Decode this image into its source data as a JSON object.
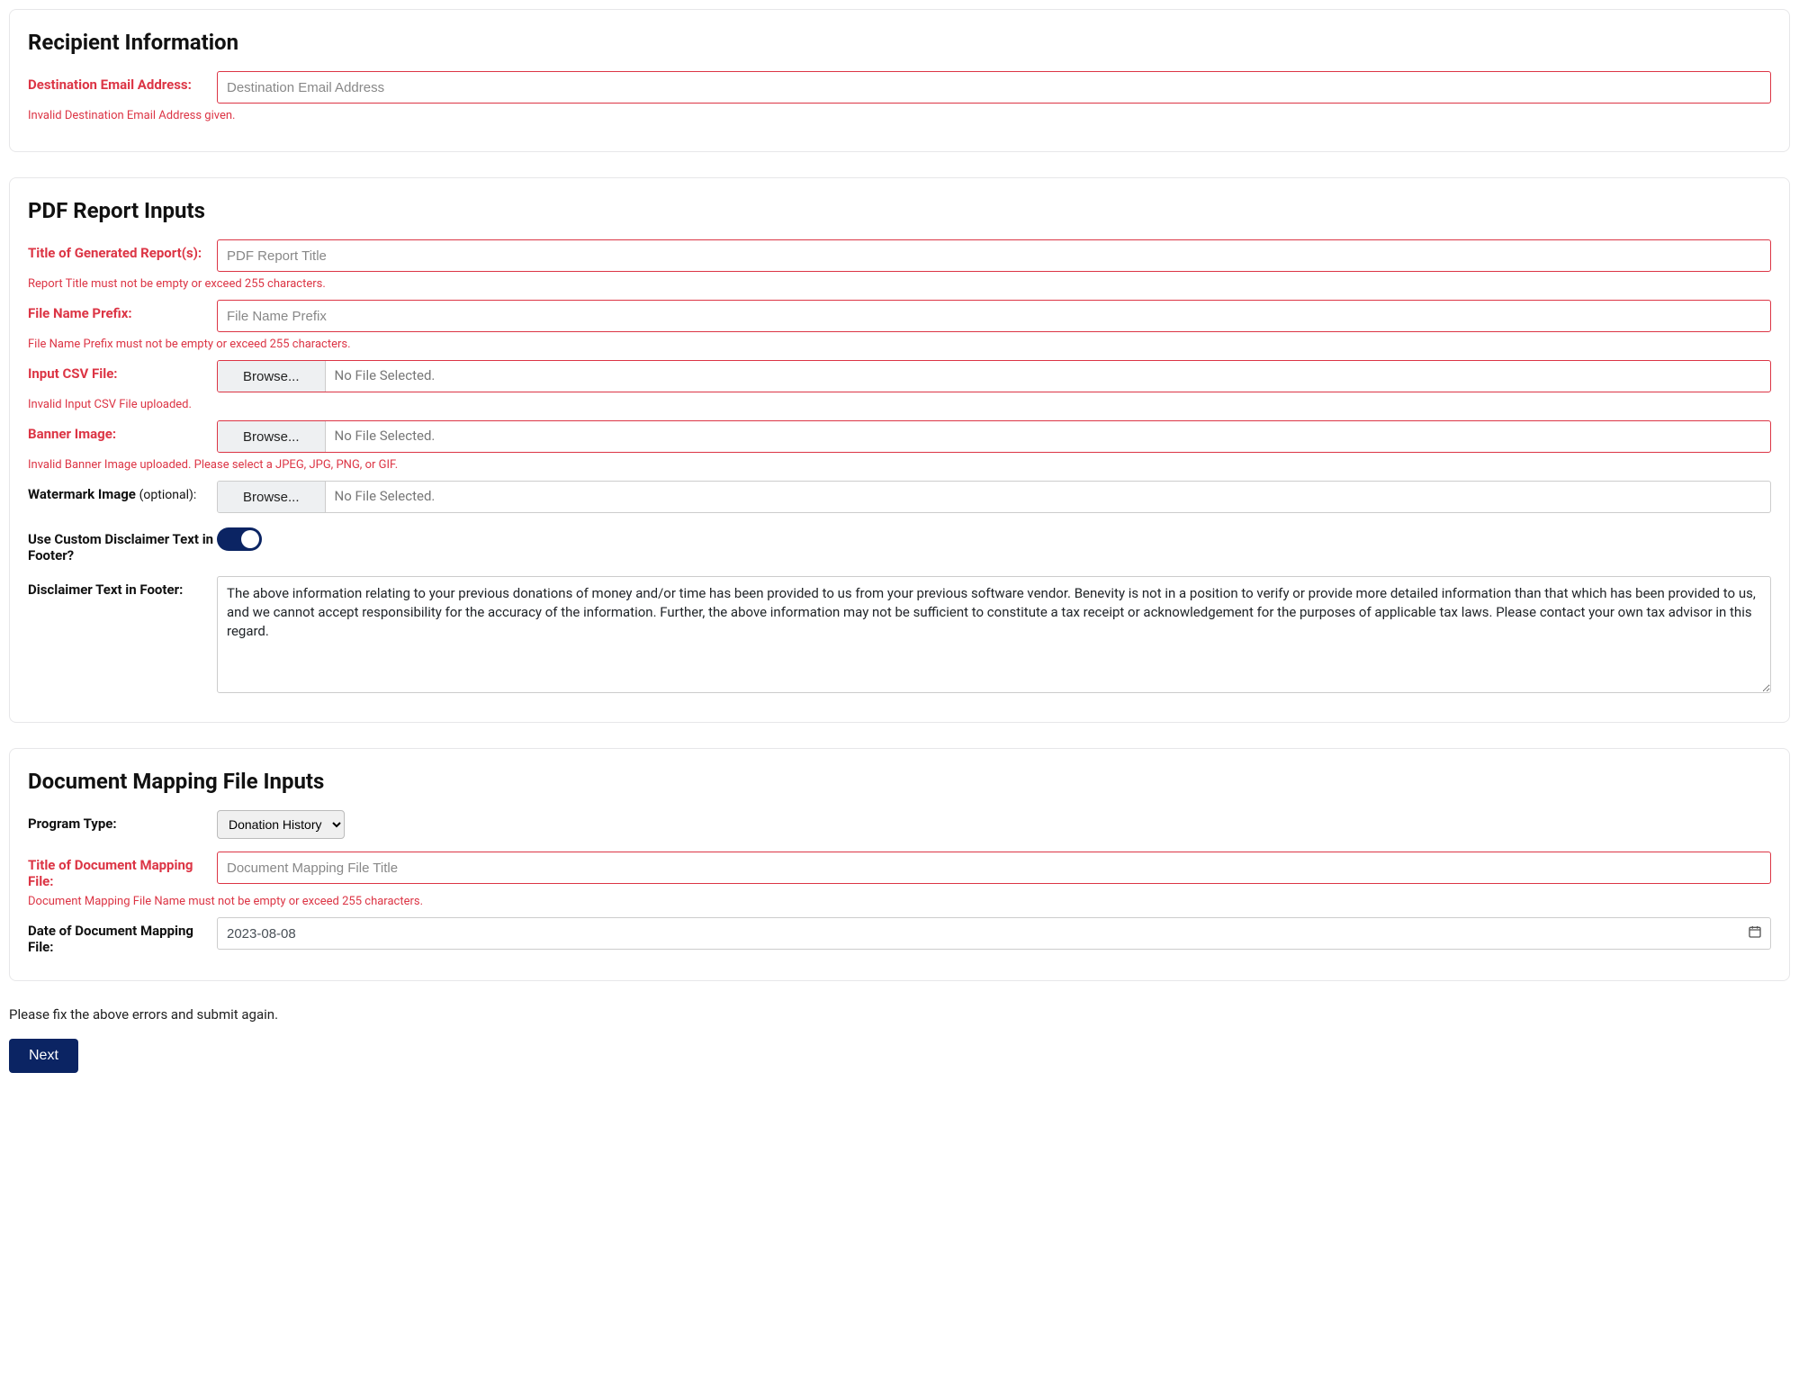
{
  "recipient": {
    "title": "Recipient Information",
    "email_label": "Destination Email Address:",
    "email_placeholder": "Destination Email Address",
    "email_error": "Invalid Destination Email Address given."
  },
  "pdf": {
    "title": "PDF Report Inputs",
    "report_title_label": "Title of Generated Report(s):",
    "report_title_placeholder": "PDF Report Title",
    "report_title_error": "Report Title must not be empty or exceed 255 characters.",
    "file_prefix_label": "File Name Prefix:",
    "file_prefix_placeholder": "File Name Prefix",
    "file_prefix_error": "File Name Prefix must not be empty or exceed 255 characters.",
    "csv_label": "Input CSV File:",
    "csv_error": "Invalid Input CSV File uploaded.",
    "banner_label": "Banner Image:",
    "banner_error": "Invalid Banner Image uploaded. Please select a JPEG, JPG, PNG, or GIF.",
    "watermark_label": "Watermark Image ",
    "watermark_optional": "(optional):",
    "disclaimer_toggle_label": "Use Custom Disclaimer Text in Footer?",
    "disclaimer_text_label": "Disclaimer Text in Footer:",
    "disclaimer_value": "The above information relating to your previous donations of money and/or time has been provided to us from your previous software vendor. Benevity is not in a position to verify or provide more detailed information than that which has been provided to us, and we cannot accept responsibility for the accuracy of the information. Further, the above information may not be sufficient to constitute a tax receipt or acknowledgement for the purposes of applicable tax laws. Please contact your own tax advisor in this regard."
  },
  "file_picker": {
    "browse_label": "Browse...",
    "none_selected": "No File Selected."
  },
  "mapping": {
    "title": "Document Mapping File Inputs",
    "program_type_label": "Program Type:",
    "program_type_value": "Donation History",
    "mapping_title_label": "Title of Document Mapping File:",
    "mapping_title_placeholder": "Document Mapping File Title",
    "mapping_title_error": "Document Mapping File Name must not be empty or exceed 255 characters.",
    "mapping_date_label": "Date of Document Mapping File:",
    "mapping_date_value": "2023-08-08"
  },
  "footer": {
    "global_error": "Please fix the above errors and submit again.",
    "next_label": "Next"
  }
}
